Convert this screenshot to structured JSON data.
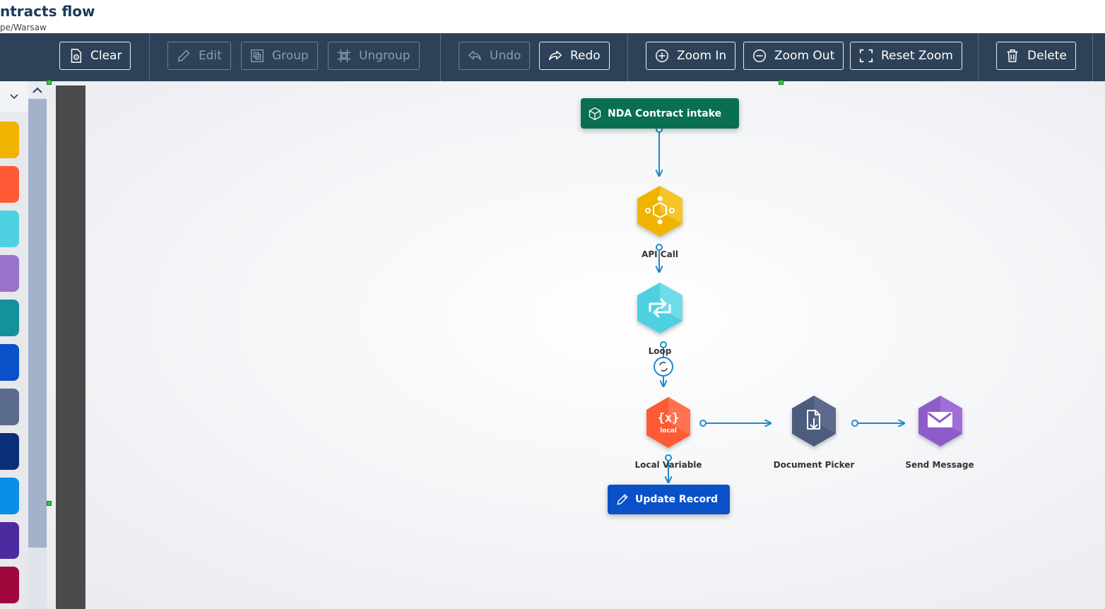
{
  "header": {
    "title": "ntracts flow",
    "subtitle": "pe/Warsaw"
  },
  "toolbar": {
    "clear": "Clear",
    "edit": "Edit",
    "group": "Group",
    "ungroup": "Ungroup",
    "undo": "Undo",
    "redo": "Redo",
    "zoom_in": "Zoom In",
    "zoom_out": "Zoom Out",
    "reset_zoom": "Reset Zoom",
    "delete": "Delete"
  },
  "palette": {
    "colors": [
      "#f0b400",
      "#ff5a36",
      "#4fd0e0",
      "#9b72cb",
      "#14919b",
      "#0a50c8",
      "#5a6b8c",
      "#0a2e78",
      "#0a8ee8",
      "#4e2aa0",
      "#a0073c"
    ]
  },
  "flow": {
    "start": {
      "label": "NDA Contract intake",
      "color": "#0a6e52"
    },
    "api_call": {
      "label": "API Call",
      "color": "#f0b400"
    },
    "loop": {
      "label": "Loop",
      "color": "#4fd0e0"
    },
    "local_variable": {
      "label": "Local Variable",
      "icon_text": "{x}",
      "sub_text": "local",
      "color": "#ff5a36"
    },
    "document_picker": {
      "label": "Document Picker",
      "color": "#4e5b7c"
    },
    "send_message": {
      "label": "Send Message",
      "color": "#8e5cc8"
    },
    "update_record": {
      "label": "Update Record",
      "color": "#0a50c8"
    }
  }
}
